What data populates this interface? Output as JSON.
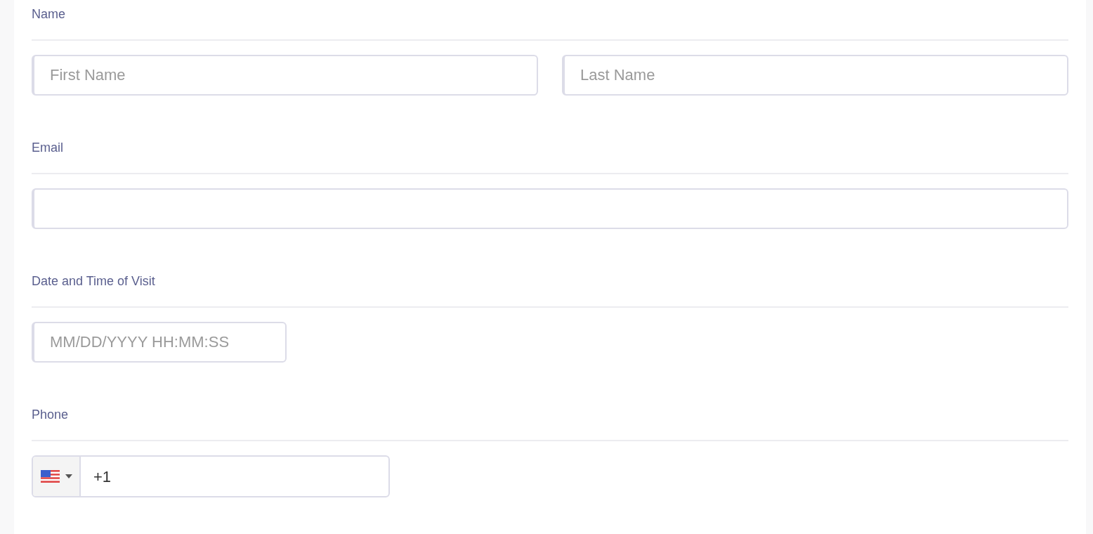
{
  "sections": [
    {
      "label": "Name",
      "kind": "pair",
      "fields": [
        {
          "placeholder": "First Name"
        },
        {
          "placeholder": "Last Name"
        }
      ]
    },
    {
      "label": "Email",
      "kind": "full"
    },
    {
      "label": "Date and Time of Visit",
      "kind": "short",
      "fields": [
        {
          "placeholder": "MM/DD/YYYY HH:MM:SS"
        }
      ]
    },
    {
      "label": "Phone",
      "kind": "phone",
      "fields": [
        {
          "value": "+1"
        }
      ]
    }
  ]
}
